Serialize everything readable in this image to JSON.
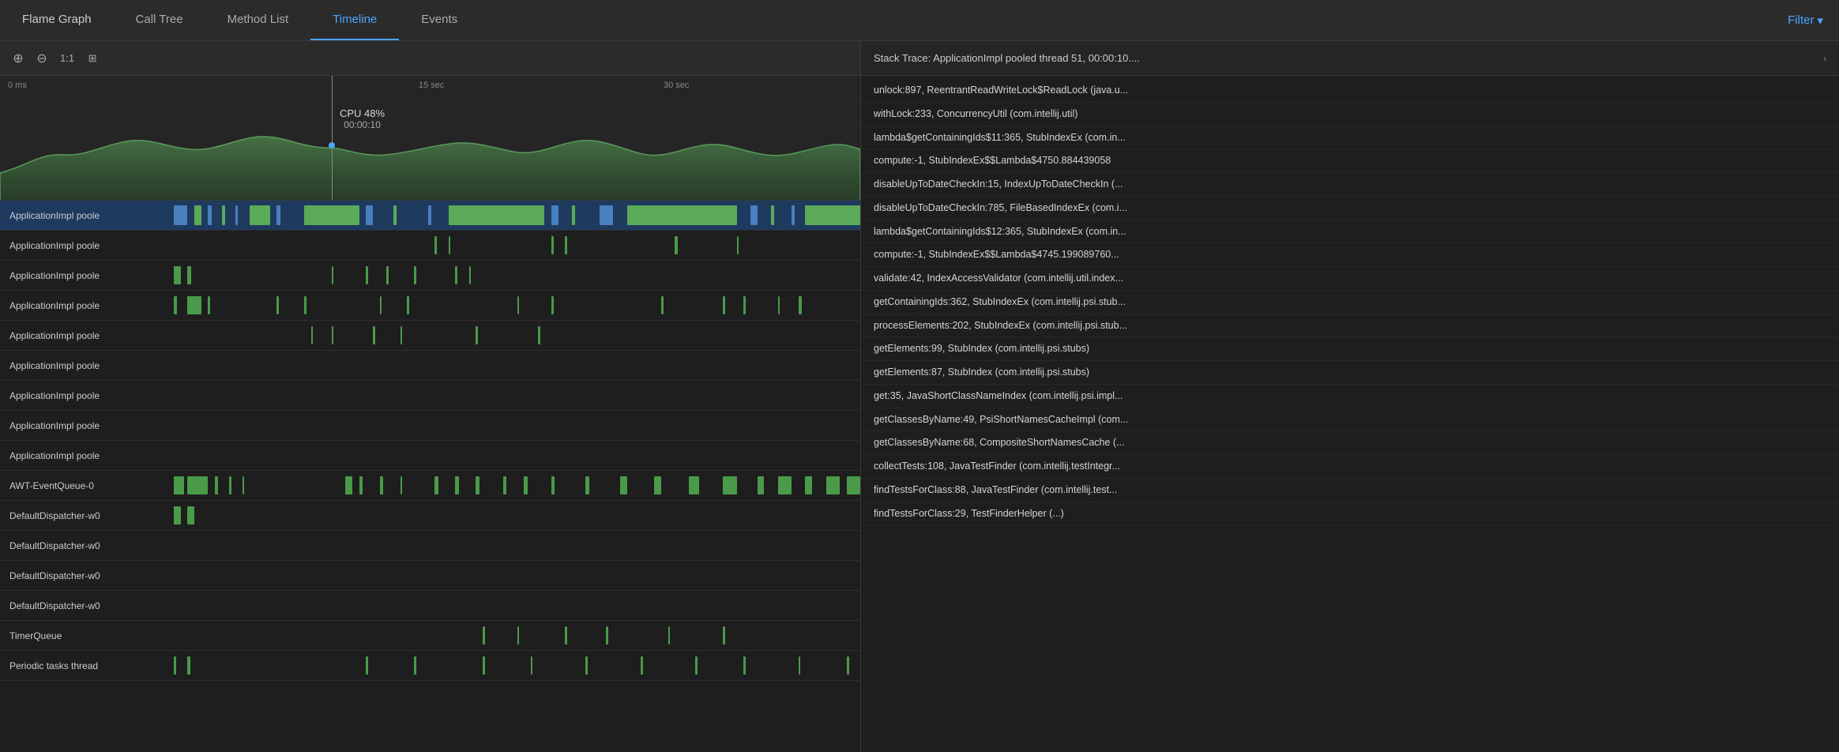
{
  "tabs": [
    {
      "id": "flame-graph",
      "label": "Flame Graph",
      "active": false
    },
    {
      "id": "call-tree",
      "label": "Call Tree",
      "active": false
    },
    {
      "id": "method-list",
      "label": "Method List",
      "active": false
    },
    {
      "id": "timeline",
      "label": "Timeline",
      "active": true
    },
    {
      "id": "events",
      "label": "Events",
      "active": false
    }
  ],
  "filter_button": "Filter",
  "toolbar": {
    "plus_label": "+",
    "minus_label": "−",
    "ratio_label": "1:1"
  },
  "cpu_chart": {
    "time_labels": [
      "0 ms",
      "15 sec",
      "30 sec"
    ],
    "cpu_percent": "CPU 48%",
    "cpu_time": "00:00:10"
  },
  "threads": [
    {
      "name": "ApplicationImpl poole",
      "selected": true
    },
    {
      "name": "ApplicationImpl poole",
      "selected": false
    },
    {
      "name": "ApplicationImpl poole",
      "selected": false
    },
    {
      "name": "ApplicationImpl poole",
      "selected": false
    },
    {
      "name": "ApplicationImpl poole",
      "selected": false
    },
    {
      "name": "ApplicationImpl poole",
      "selected": false
    },
    {
      "name": "ApplicationImpl poole",
      "selected": false
    },
    {
      "name": "ApplicationImpl poole",
      "selected": false
    },
    {
      "name": "ApplicationImpl poole",
      "selected": false
    },
    {
      "name": "AWT-EventQueue-0",
      "selected": false
    },
    {
      "name": "DefaultDispatcher-w0",
      "selected": false
    },
    {
      "name": "DefaultDispatcher-w0",
      "selected": false
    },
    {
      "name": "DefaultDispatcher-w0",
      "selected": false
    },
    {
      "name": "DefaultDispatcher-w0",
      "selected": false
    },
    {
      "name": "TimerQueue",
      "selected": false
    },
    {
      "name": "Periodic tasks thread",
      "selected": false
    }
  ],
  "stack_trace": {
    "header": "Stack Trace: ApplicationImpl pooled thread 51, 00:00:10....",
    "items": [
      {
        "text": "unlock:897, ReentrantReadWriteLock$ReadLock (java.u..."
      },
      {
        "text": "withLock:233, ConcurrencyUtil (com.intellij.util)"
      },
      {
        "text": "lambda$getContainingIds$11:365, StubIndexEx (com.in..."
      },
      {
        "text": "compute:-1, StubIndexEx$$Lambda$4750.884439058"
      },
      {
        "text": "disableUpToDateCheckIn:15, IndexUpToDateCheckIn (..."
      },
      {
        "text": "disableUpToDateCheckIn:785, FileBasedIndexEx (com.i..."
      },
      {
        "text": "lambda$getContainingIds$12:365, StubIndexEx (com.in..."
      },
      {
        "text": "compute:-1, StubIndexEx$$Lambda$4745.199089760..."
      },
      {
        "text": "validate:42, IndexAccessValidator (com.intellij.util.index..."
      },
      {
        "text": "getContainingIds:362, StubIndexEx (com.intellij.psi.stub..."
      },
      {
        "text": "processElements:202, StubIndexEx (com.intellij.psi.stub..."
      },
      {
        "text": "getElements:99, StubIndex (com.intellij.psi.stubs)"
      },
      {
        "text": "getElements:87, StubIndex (com.intellij.psi.stubs)"
      },
      {
        "text": "get:35, JavaShortClassNameIndex (com.intellij.psi.impl..."
      },
      {
        "text": "getClassesByName:49, PsiShortNamesCacheImpl (com..."
      },
      {
        "text": "getClassesByName:68, CompositeShortNamesCache (..."
      },
      {
        "text": "collectTests:108, JavaTestFinder (com.intellij.testIntegr..."
      },
      {
        "text": "findTestsForClass:88, JavaTestFinder (com.intellij.test..."
      },
      {
        "text": "findTestsForClass:29, TestFinderHelper (...)"
      }
    ]
  }
}
